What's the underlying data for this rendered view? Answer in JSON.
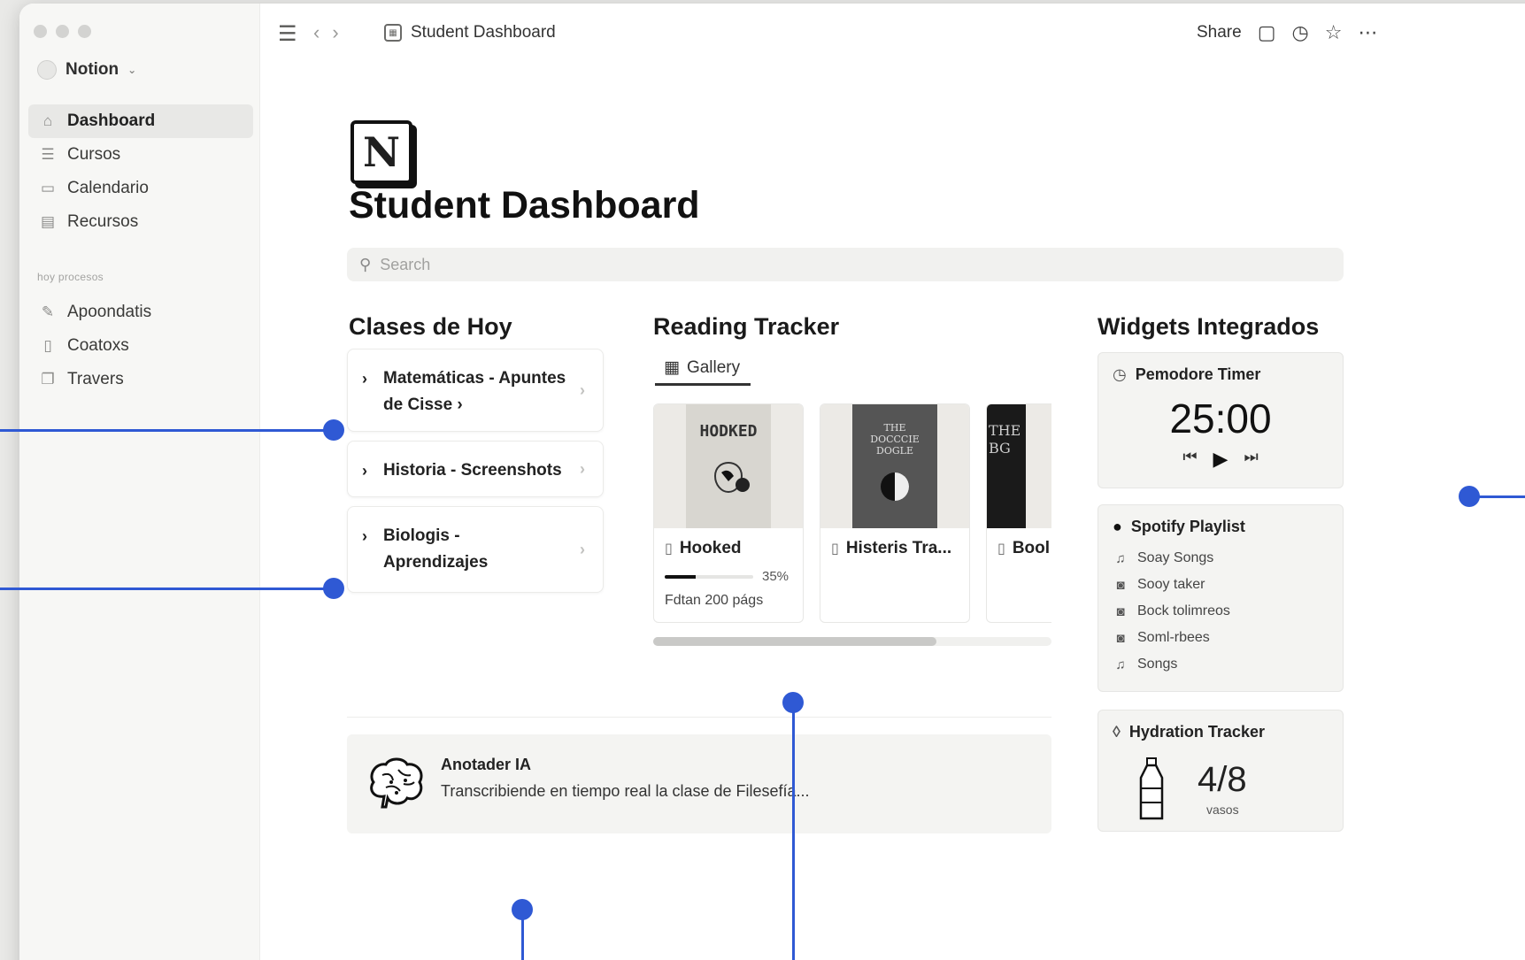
{
  "window": {
    "traffic_lights": [
      "close",
      "minimize",
      "zoom"
    ]
  },
  "workspace": {
    "name": "Notion",
    "chevron": "⌄"
  },
  "sidebar": {
    "items": [
      {
        "label": "Dashboard",
        "icon": "home-icon",
        "active": true
      },
      {
        "label": "Cursos",
        "icon": "stack-icon"
      },
      {
        "label": "Calendario",
        "icon": "calendar-icon"
      },
      {
        "label": "Recursos",
        "icon": "document-icon"
      }
    ],
    "section_label": "hoy procesos",
    "section_items": [
      {
        "label": "Apoondatis",
        "icon": "pencil-icon"
      },
      {
        "label": "Coatoxs",
        "icon": "page-icon"
      },
      {
        "label": "Travers",
        "icon": "copy-icon"
      }
    ]
  },
  "topbar": {
    "breadcrumb": "Student Dashboard",
    "share_label": "Share"
  },
  "page": {
    "title": "Student Dashboard",
    "search_placeholder": "Search",
    "classes": {
      "title": "Clases de Hoy",
      "items": [
        "Matemáticas - Apuntes de Cisse ›",
        "Historia - Screenshots",
        "Biologis - Aprendizajes"
      ]
    },
    "reading": {
      "title": "Reading Tracker",
      "view_tab": "Gallery",
      "books": [
        {
          "name": "Hooked",
          "cover_text": "HODKED",
          "progress": 0.35,
          "progress_label": "35%",
          "pages_left": "Fdtan 200 págs"
        },
        {
          "name": "Histeris Tra...",
          "cover_text": "THE DOCCCIE DOGLE"
        },
        {
          "name": "Bool",
          "cover_text": "THE BG"
        }
      ],
      "scroll_position": 0.71
    },
    "ai": {
      "title": "Anotader IA",
      "text": "Transcribiende en tiempo real la clase de Filesefía..."
    },
    "widgets": {
      "title": "Widgets Integrados",
      "pomodoro": {
        "title": "Pemodore Timer",
        "time": "25:00"
      },
      "spotify": {
        "title": "Spotify Playlist",
        "items": [
          {
            "label": "Soay Songs",
            "icon": "music-note-icon"
          },
          {
            "label": "Sooy taker",
            "icon": "playlist-icon"
          },
          {
            "label": "Bock tolimreos",
            "icon": "playlist-icon"
          },
          {
            "label": "Soml-rbees",
            "icon": "playlist-icon"
          },
          {
            "label": "Songs",
            "icon": "music-note-icon"
          }
        ]
      },
      "hydration": {
        "title": "Hydration Tracker",
        "count": "4/8",
        "unit": "vasos",
        "value": 4,
        "goal": 8
      }
    }
  },
  "colors": {
    "annotation": "#2f59d4",
    "sidebar_bg": "#f7f7f5",
    "card_bg": "#f4f4f2"
  }
}
